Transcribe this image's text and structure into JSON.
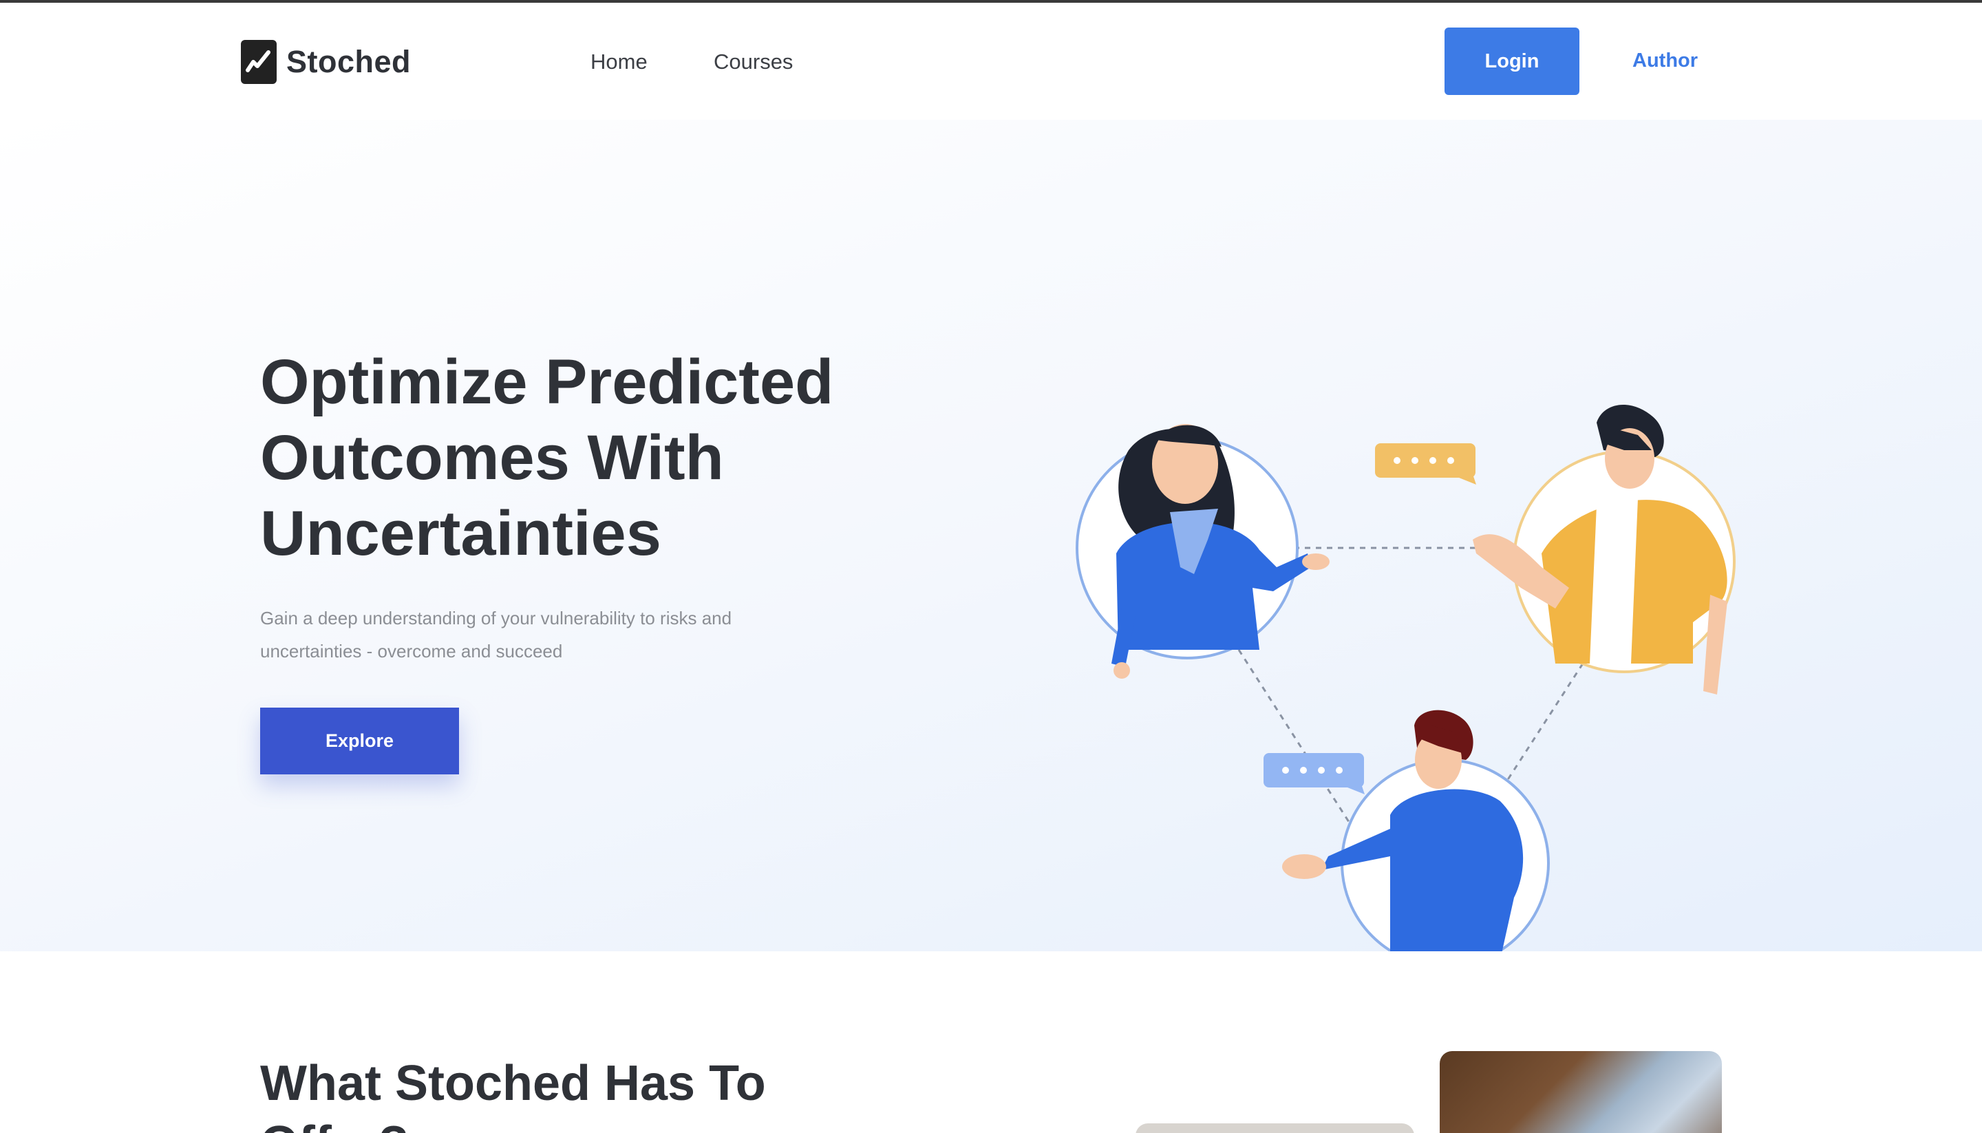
{
  "brand": {
    "name": "Stoched"
  },
  "nav": {
    "links": [
      "Home",
      "Courses"
    ],
    "login_label": "Login",
    "author_label": "Author"
  },
  "hero": {
    "title": "Optimize Predicted Outcomes With Uncertainties",
    "subtitle": "Gain a deep understanding of your vulnerability to risks and uncertainties - overcome and succeed",
    "cta_label": "Explore"
  },
  "offer": {
    "title": "What Stoched Has To Offer?"
  },
  "colors": {
    "accent_blue": "#3d7be6",
    "cta_blue": "#3a55cf",
    "heading": "#2f3238",
    "muted": "#8b8e94",
    "yellow": "#f2b544"
  },
  "icons": {
    "logo": "stoched-logo-mark"
  }
}
